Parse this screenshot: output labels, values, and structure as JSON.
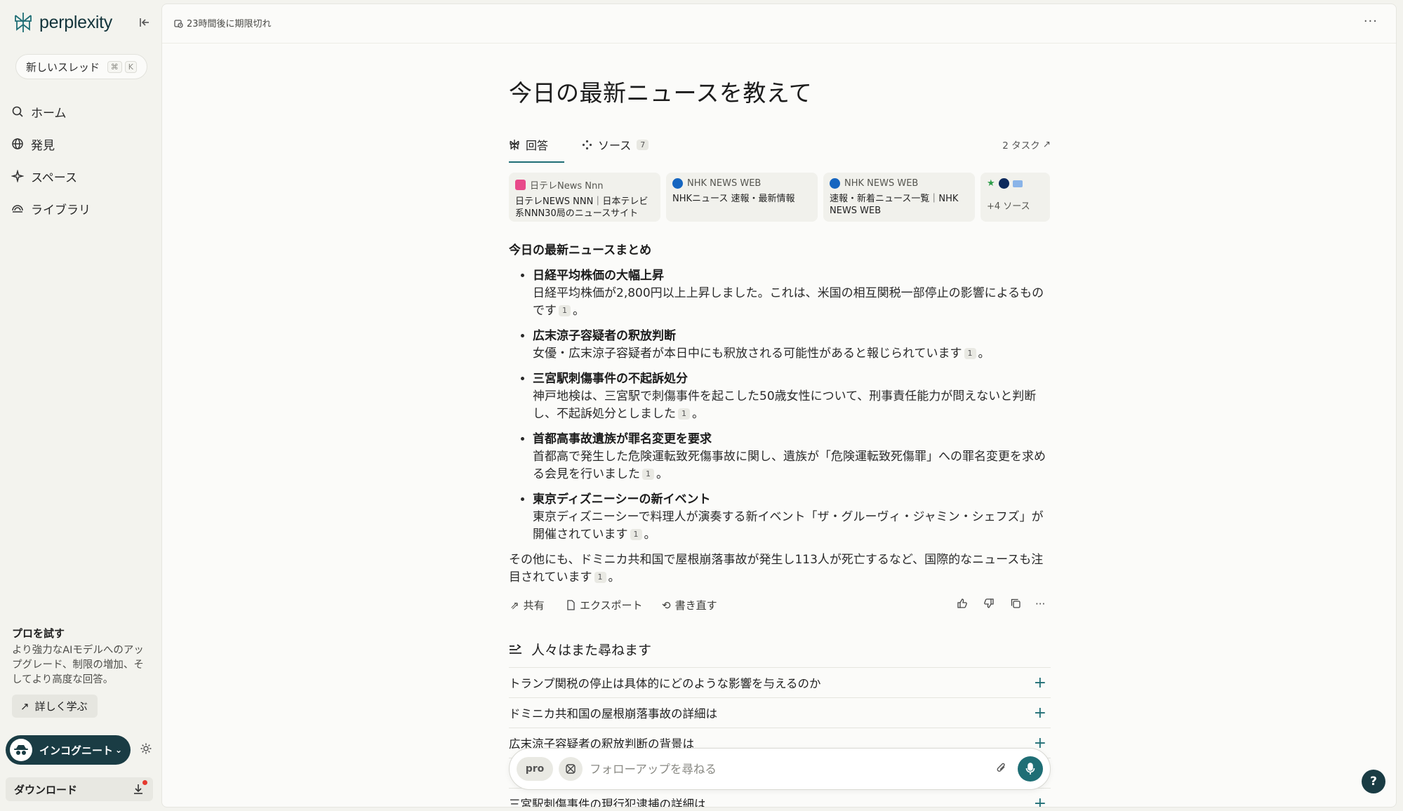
{
  "app": {
    "name": "perplexity"
  },
  "sidebar": {
    "new_thread": "新しいスレッド",
    "shortcut_cmd": "⌘",
    "shortcut_key": "K",
    "items": [
      {
        "label": "ホーム",
        "icon": "search-icon"
      },
      {
        "label": "発見",
        "icon": "globe-icon"
      },
      {
        "label": "スペース",
        "icon": "sparkle-icon"
      },
      {
        "label": "ライブラリ",
        "icon": "library-icon"
      }
    ],
    "promo_title": "プロを試す",
    "promo_text": "より強力なAIモデルへのアップグレード、制限の増加、そしてより高度な回答。",
    "learn_more": "詳しく学ぶ",
    "incognito": "インコグニート",
    "download": "ダウンロード"
  },
  "topbar": {
    "expire": "23時間後に期限切れ"
  },
  "thread": {
    "question": "今日の最新ニュースを教えて",
    "tab_answer": "回答",
    "tab_sources": "ソース",
    "sources_count": "7",
    "tasks": "2 タスク",
    "sources": [
      {
        "site": "日テレNews Nnn",
        "title": "日テレNEWS NNN｜日本テレビ系NNN30局のニュースサイト",
        "color": "#e84a8a"
      },
      {
        "site": "NHK NEWS WEB",
        "title": "NHKニュース 速報・最新情報",
        "color": "#1565c0"
      },
      {
        "site": "NHK NEWS WEB",
        "title": "速報・新着ニュース一覧｜NHK NEWS WEB",
        "color": "#1565c0"
      }
    ],
    "more_sources": "+4 ソース",
    "answer_heading": "今日の最新ニュースまとめ",
    "bullets": [
      {
        "title": "日経平均株価の大幅上昇",
        "text": "日経平均株価が2,800円以上上昇しました。これは、米国の相互関税一部停止の影響によるものです",
        "cite": "1"
      },
      {
        "title": "広末涼子容疑者の釈放判断",
        "text": "女優・広末涼子容疑者が本日中にも釈放される可能性があると報じられています",
        "cite": "1"
      },
      {
        "title": "三宮駅刺傷事件の不起訴処分",
        "text": "神戸地検は、三宮駅で刺傷事件を起こした50歳女性について、刑事責任能力が問えないと判断し、不起訴処分としました",
        "cite": "1"
      },
      {
        "title": "首都高事故遺族が罪名変更を要求",
        "text": "首都高で発生した危険運転致死傷事故に関し、遺族が「危険運転致死傷罪」への罪名変更を求める会見を行いました",
        "cite": "1"
      },
      {
        "title": "東京ディズニーシーの新イベント",
        "text": "東京ディズニーシーで料理人が演奏する新イベント「ザ・グルーヴィ・ジャミン・シェフズ」が開催されています",
        "cite": "1"
      }
    ],
    "footer_text": "その他にも、ドミニカ共和国で屋根崩落事故が発生し113人が死亡するなど、国際的なニュースも注目されています",
    "footer_cite": "1",
    "period": "。",
    "actions": {
      "share": "共有",
      "export": "エクスポート",
      "rewrite": "書き直す"
    },
    "related_heading": "人々はまた尋ねます",
    "related": [
      "トランプ関税の停止は具体的にどのような影響を与えるのか",
      "ドミニカ共和国の屋根崩落事故の詳細は",
      "広末涼子容疑者の釈放判断の背景は",
      "",
      "三宮駅刺傷事件の現行犯逮捕の詳細は"
    ]
  },
  "ask": {
    "placeholder": "フォローアップを尋ねる",
    "pro_label": "pro"
  },
  "help": "?",
  "colors": {
    "accent": "#1f6e75",
    "dark": "#1a3c44"
  }
}
